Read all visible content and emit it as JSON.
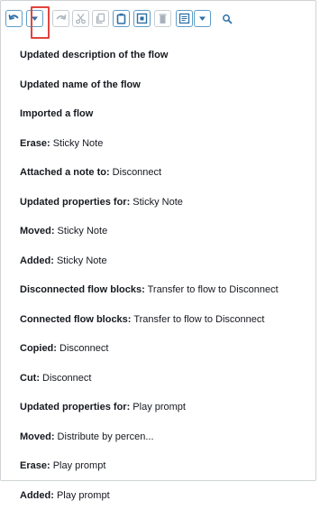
{
  "toolbar": {
    "buttons": [
      {
        "name": "undo-button",
        "icon": "undo-icon"
      },
      {
        "name": "undo-history-dropdown-button",
        "icon": "caret-down-icon"
      },
      {
        "name": "redo-button",
        "icon": "redo-icon"
      },
      {
        "name": "cut-button",
        "icon": "scissors-icon"
      },
      {
        "name": "copy-button",
        "icon": "copy-icon"
      },
      {
        "name": "paste-button",
        "icon": "clipboard-icon"
      },
      {
        "name": "select-button",
        "icon": "frame-icon"
      },
      {
        "name": "delete-button",
        "icon": "trash-icon"
      },
      {
        "name": "notes-button",
        "icon": "note-icon"
      },
      {
        "name": "notes-dropdown-button",
        "icon": "caret-down-icon"
      },
      {
        "name": "search-button",
        "icon": "search-icon"
      }
    ],
    "colors": {
      "active_icon": "#2d6fa6",
      "disabled_icon": "#a9b2bb",
      "highlight": "#e0443e"
    }
  },
  "history": [
    {
      "label": "Updated description of the flow",
      "target": ""
    },
    {
      "label": "Updated name of the flow",
      "target": ""
    },
    {
      "label": "Imported a flow",
      "target": ""
    },
    {
      "label": "Erase:",
      "target": " Sticky Note"
    },
    {
      "label": "Attached a note to:",
      "target": " Disconnect"
    },
    {
      "label": "Updated properties for:",
      "target": " Sticky Note"
    },
    {
      "label": "Moved:",
      "target": " Sticky Note"
    },
    {
      "label": "Added:",
      "target": " Sticky Note"
    },
    {
      "label": "Disconnected flow blocks:",
      "target": " Transfer to flow to Disconnect"
    },
    {
      "label": "Connected flow blocks:",
      "target": " Transfer to flow to Disconnect"
    },
    {
      "label": "Copied:",
      "target": " Disconnect"
    },
    {
      "label": "Cut:",
      "target": " Disconnect"
    },
    {
      "label": "Updated properties for:",
      "target": " Play prompt"
    },
    {
      "label": "Moved:",
      "target": " Distribute by percen..."
    },
    {
      "label": "Erase:",
      "target": " Play prompt"
    },
    {
      "label": "Added:",
      "target": " Play prompt"
    }
  ]
}
